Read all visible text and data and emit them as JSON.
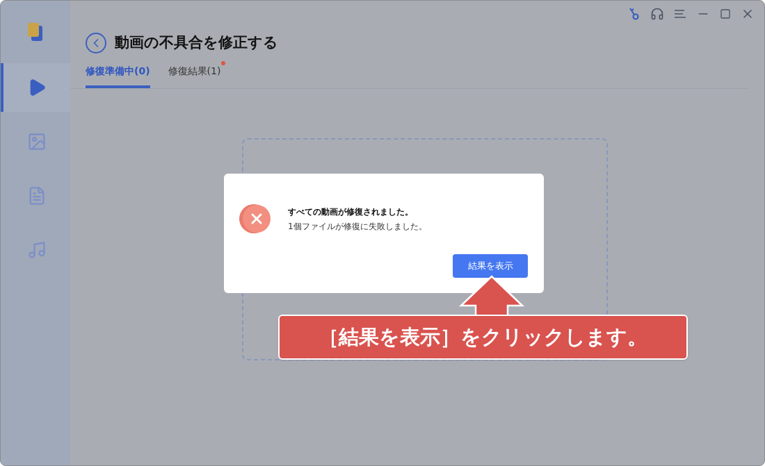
{
  "header": {
    "title": "動画の不具合を修正する"
  },
  "tabs": [
    {
      "label": "修復準備中(0)",
      "selected": true,
      "badge": false
    },
    {
      "label": "修復結果(1)",
      "selected": false,
      "badge": true
    }
  ],
  "sidebar": {
    "items": [
      {
        "kind": "video",
        "selected": true
      },
      {
        "kind": "photo",
        "selected": false
      },
      {
        "kind": "document",
        "selected": false
      },
      {
        "kind": "audio",
        "selected": false
      }
    ]
  },
  "dialog": {
    "title": "すべての動画が修復されました。",
    "message": "1個ファイルが修復に失敗しました。",
    "button": "結果を表示"
  },
  "callout": {
    "text": "［結果を表示］をクリックします。"
  }
}
